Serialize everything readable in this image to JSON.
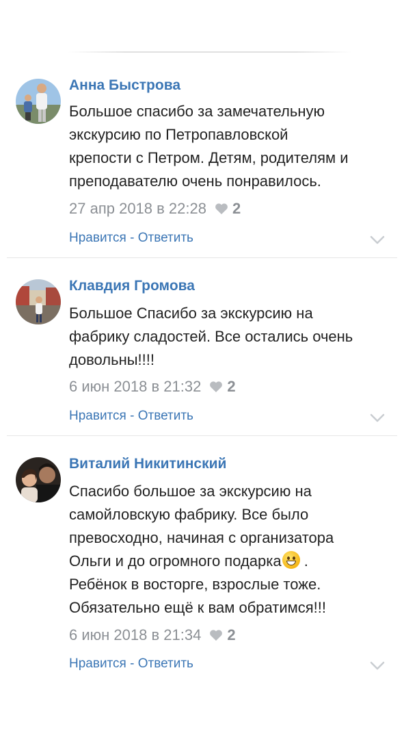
{
  "comments": [
    {
      "author": "Анна Быстрова",
      "lines": [
        "Большое спасибо за замечательную",
        "экскурсию по Петропавловской",
        "крепости с Петром. Детям, родителям и",
        "преподавателю очень понравилось."
      ],
      "date": "27 апр 2018 в 22:28",
      "likes": "2",
      "like_label": "Нравится",
      "separator": " - ",
      "reply_label": "Ответить"
    },
    {
      "author": "Клавдия Громова",
      "lines": [
        "Большое Спасибо за экскурсию на",
        "фабрику сладостей. Все остались очень",
        "довольны!!!!"
      ],
      "date": "6 июн 2018 в 21:32",
      "likes": "2",
      "like_label": "Нравится",
      "separator": " - ",
      "reply_label": "Ответить"
    },
    {
      "author": "Виталий Никитинский",
      "lines": [
        "Спасибо большое за экскурсию на",
        "самойловскую фабрику. Все было",
        "превосходно, начиная с организатора",
        "Ольги и до огромного подарка",
        "Ребёнок в восторге, взрослые тоже.",
        "Обязательно ещё к вам обратимся!!!"
      ],
      "line4_suffix": " .",
      "emoji": "grinning-face-emoji",
      "date": "6 июн 2018 в 21:34",
      "likes": "2",
      "like_label": "Нравится",
      "separator": " - ",
      "reply_label": "Ответить"
    }
  ],
  "colors": {
    "link": "#3b76b5",
    "text": "#222222",
    "meta": "#8b8f94",
    "divider": "#e6e6e6"
  },
  "icons": {
    "heart": "heart-icon",
    "chevron": "chevron-down-icon"
  }
}
